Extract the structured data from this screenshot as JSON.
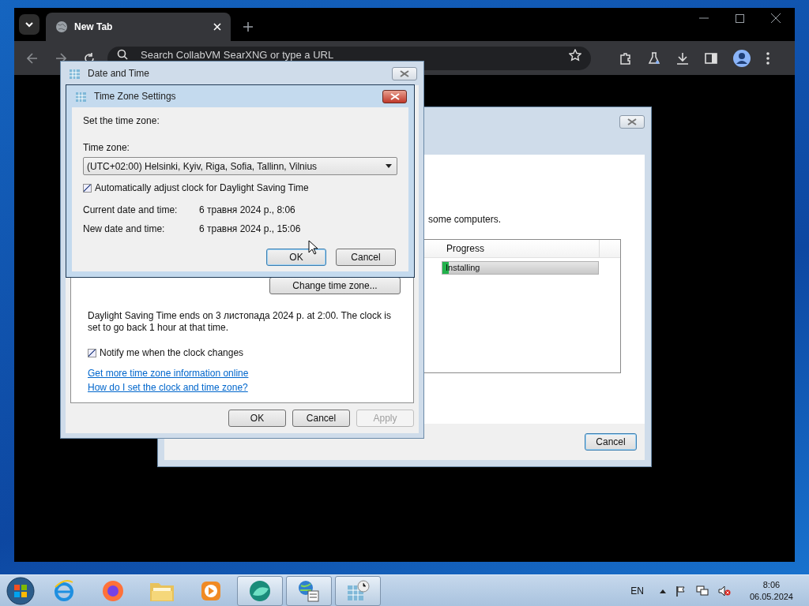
{
  "browser": {
    "tabs": [
      {
        "title": "New Tab",
        "selected": true
      }
    ],
    "address_placeholder": "Search CollabVM SearXNG or type a URL"
  },
  "installer": {
    "text": "some computers.",
    "column": "Progress",
    "status": "Installing",
    "level": 0.04,
    "button": "Cancel"
  },
  "date_and_time": {
    "title": "Date and Time",
    "change_button": "Change time zone...",
    "dst_text": "Daylight Saving Time ends on 3 листопада 2024 р. at 2:00. The clock is set to go back 1 hour at that time.",
    "notify": {
      "label": "Notify me when the clock changes",
      "checked": true
    },
    "links": [
      "Get more time zone information online",
      "How do I set the clock and time zone?"
    ],
    "buttons": [
      {
        "label": "OK",
        "disabled": false
      },
      {
        "label": "Cancel",
        "disabled": false
      },
      {
        "label": "Apply",
        "disabled": true
      }
    ]
  },
  "time_zone_settings": {
    "title": "Time Zone Settings",
    "prompt": "Set the time zone:",
    "zone_label": "Time zone:",
    "zone": "(UTC+02:00) Helsinki, Kyiv, Riga, Sofia, Tallinn, Vilnius",
    "auto_adjust": {
      "label": "Automatically adjust clock for Daylight Saving Time",
      "checked": true
    },
    "rows": [
      {
        "label": "Current date and time:",
        "value": "6 травня 2024 р., 8:06"
      },
      {
        "label": "New date and time:",
        "value": "6 травня 2024 р., 15:06"
      }
    ],
    "buttons": [
      {
        "label": "OK",
        "default": true
      },
      {
        "label": "Cancel",
        "default": false
      }
    ]
  },
  "taskbar": {
    "apps": [
      {
        "kind": "ie",
        "open": false
      },
      {
        "kind": "firefox",
        "open": false
      },
      {
        "kind": "folder",
        "open": false
      },
      {
        "kind": "media",
        "open": false
      },
      {
        "kind": "globe",
        "open": true
      },
      {
        "kind": "network",
        "open": true
      },
      {
        "kind": "calendar",
        "open": true
      }
    ],
    "language": "EN",
    "time": "8:06",
    "date": "06.05.2024"
  }
}
